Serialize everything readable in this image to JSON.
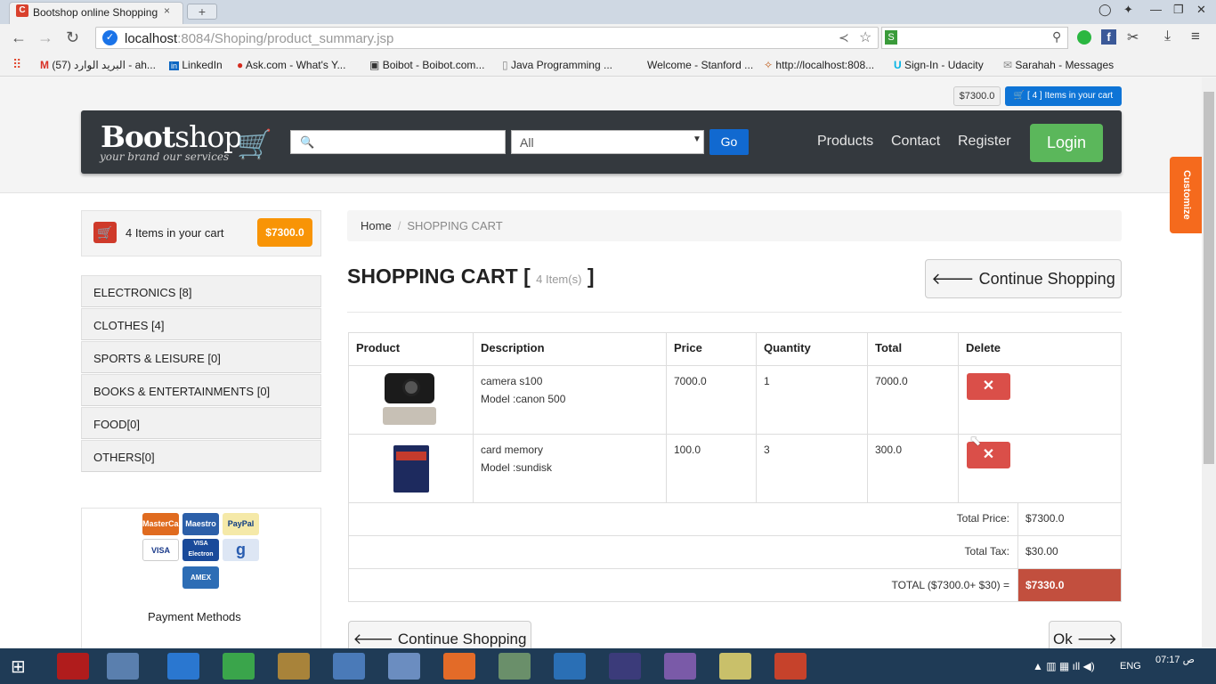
{
  "browser": {
    "tab_title": "Bootshop online Shopping",
    "tab_close": "×",
    "new_tab": "+",
    "url_host": "localhost",
    "url_rest": ":8084/Shoping/product_summary.jsp",
    "bookmarks": [
      "البريد الوارد (57) - ah...",
      "LinkedIn",
      "Ask.com - What's Y...",
      "Boibot - Boibot.com...",
      "Java Programming ...",
      "Welcome - Stanford ...",
      "http://localhost:808...",
      "Sign-In - Udacity",
      "Sarahah - Messages"
    ]
  },
  "header": {
    "price_badge": "$7300.0",
    "cart_badge": "[ 4 ] Items in your cart",
    "logo_bold": "Boot",
    "logo_rest": "shop",
    "slogan": "your brand our services",
    "search_placeholder": "",
    "select_value": "All",
    "go": "Go",
    "nav": [
      "Products",
      "Contact",
      "Register"
    ],
    "login": "Login",
    "customize": "Customize"
  },
  "sidebar": {
    "cart_text": "4 Items in your cart",
    "cart_price": "$7300.0",
    "categories": [
      "ELECTRONICS [8]",
      "CLOTHES [4]",
      "SPORTS & LEISURE [0]",
      "BOOKS & ENTERTAINMENTS [0]",
      "FOOD[0]",
      "OTHERS[0]"
    ],
    "payment_label": "Payment Methods",
    "cards": [
      "MasterCard",
      "Maestro",
      "PayPal",
      "VISA",
      "VISA Electron",
      "g",
      "AMEX"
    ]
  },
  "main": {
    "breadcrumb_home": "Home",
    "breadcrumb_sep": "/",
    "breadcrumb_current": "SHOPPING CART",
    "title": "SHOPPING CART [",
    "title_count": "4 Item(s)",
    "title_close": "]",
    "continue": "Continue Shopping",
    "ok": "Ok",
    "columns": [
      "Product",
      "Description",
      "Price",
      "Quantity",
      "Total",
      "Delete"
    ],
    "rows": [
      {
        "name": "camera s100",
        "model": "Model :canon 500",
        "price": "7000.0",
        "qty": "1",
        "total": "7000.0"
      },
      {
        "name": "card memory",
        "model": "Model :sundisk",
        "price": "100.0",
        "qty": "3",
        "total": "300.0"
      }
    ],
    "total_price_label": "Total Price:",
    "total_price": "$7300.0",
    "total_tax_label": "Total Tax:",
    "total_tax": "$30.00",
    "grand_label": "TOTAL ($7300.0+ $30) =",
    "grand_total": "$7330.0"
  },
  "taskbar": {
    "lang": "ENG",
    "time": "07:17",
    "ampm": "ص"
  }
}
